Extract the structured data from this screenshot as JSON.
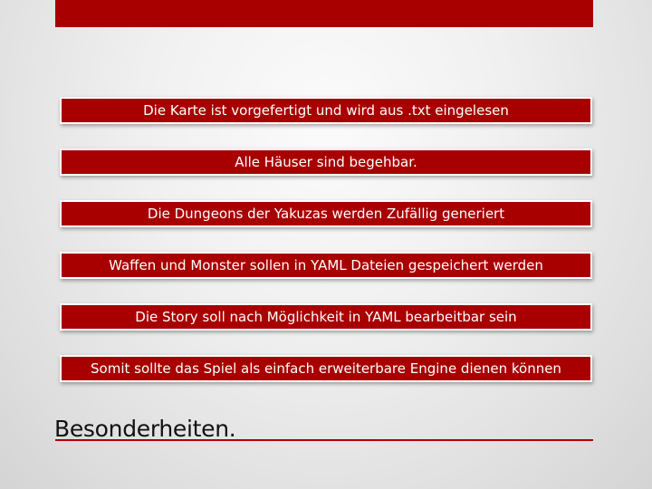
{
  "slide": {
    "title": "Besonderheiten.",
    "items": [
      "Die Karte ist vorgefertigt und wird aus .txt eingelesen",
      "Alle Häuser sind begehbar.",
      "Die Dungeons der Yakuzas werden Zufällig generiert",
      "Waffen und Monster sollen in YAML Dateien gespeichert werden",
      "Die Story soll nach Möglichkeit in YAML bearbeitbar sein",
      "Somit sollte das Spiel als einfach erweiterbare Engine dienen können"
    ]
  },
  "colors": {
    "accent": "#a80000",
    "item_text": "#ffffff",
    "title_text": "#111111"
  }
}
